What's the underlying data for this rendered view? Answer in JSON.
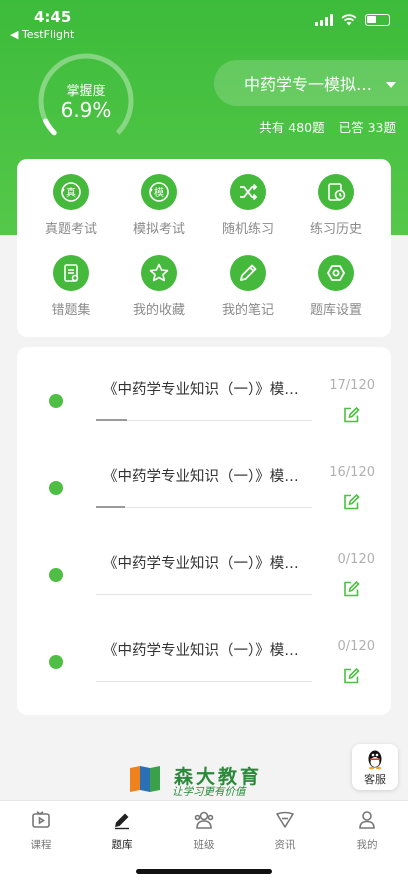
{
  "status_bar": {
    "time": "4:45",
    "back_app": "◀ TestFlight"
  },
  "header": {
    "mastery_label": "掌握度",
    "mastery_value": "6.9%",
    "mastery_fraction": 0.069,
    "bank_name": "中药学专一模拟…",
    "total_label": "共有 480题",
    "answered_label": "已答 33题"
  },
  "menu": [
    {
      "label": "真题考试",
      "icon": "zhen-exam-icon",
      "glyph": "真"
    },
    {
      "label": "模拟考试",
      "icon": "mock-exam-icon",
      "glyph": "模"
    },
    {
      "label": "随机练习",
      "icon": "shuffle-icon"
    },
    {
      "label": "练习历史",
      "icon": "history-icon"
    },
    {
      "label": "错题集",
      "icon": "wrong-set-icon"
    },
    {
      "label": "我的收藏",
      "icon": "star-icon"
    },
    {
      "label": "我的笔记",
      "icon": "pencil-icon"
    },
    {
      "label": "题库设置",
      "icon": "settings-icon"
    }
  ],
  "papers": [
    {
      "title": "《中药学专业知识（一）》模…",
      "count": "17/120",
      "progress": 0.142
    },
    {
      "title": "《中药学专业知识（一）》模…",
      "count": "16/120",
      "progress": 0.133
    },
    {
      "title": "《中药学专业知识（一）》模…",
      "count": "0/120",
      "progress": 0
    },
    {
      "title": "《中药学专业知识（一）》模…",
      "count": "0/120",
      "progress": 0
    }
  ],
  "brand": {
    "name": "森大教育",
    "slogan": "让学习更有价值"
  },
  "service": {
    "label": "客服"
  },
  "tabs": [
    {
      "label": "课程",
      "icon": "course-play-icon"
    },
    {
      "label": "题库",
      "icon": "question-bank-pen-icon"
    },
    {
      "label": "班级",
      "icon": "class-people-icon"
    },
    {
      "label": "资讯",
      "icon": "news-icon"
    },
    {
      "label": "我的",
      "icon": "profile-icon"
    }
  ],
  "colors": {
    "primary": "#45b93c",
    "header_green": "#3dbb3a",
    "dot_green": "#4fbe45",
    "muted": "#8a8a8a"
  }
}
